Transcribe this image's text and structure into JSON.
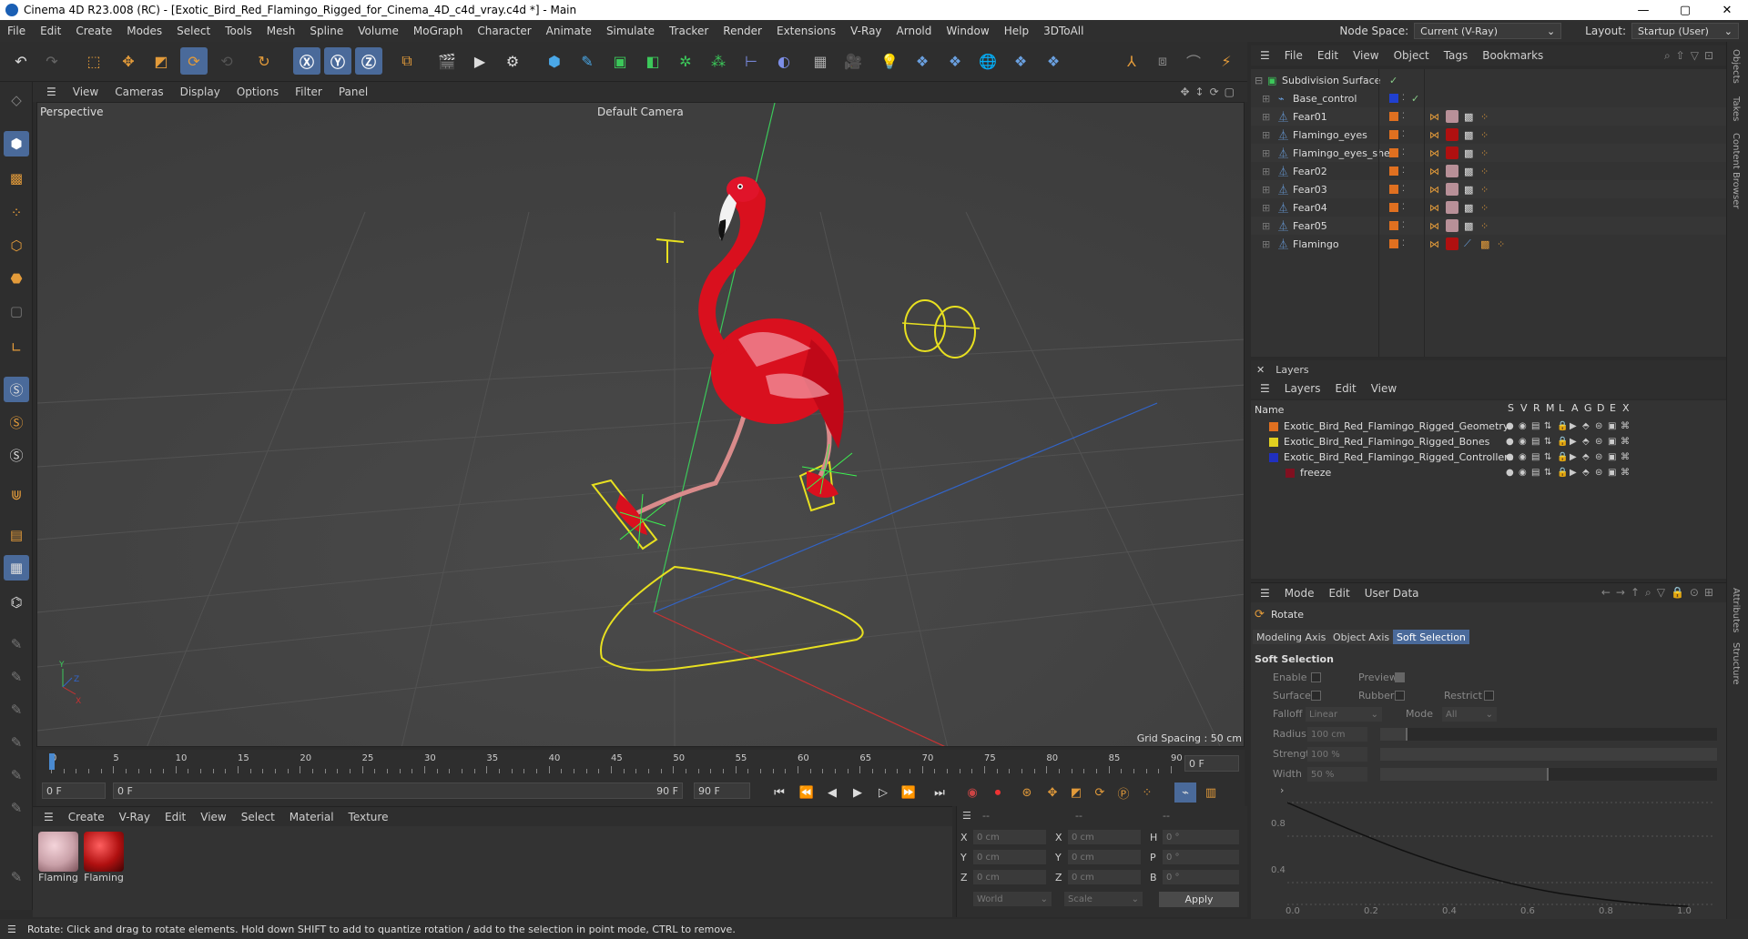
{
  "window": {
    "title": "Cinema 4D R23.008 (RC) - [Exotic_Bird_Red_Flamingo_Rigged_for_Cinema_4D_c4d_vray.c4d *] - Main",
    "controls": [
      "—",
      "▢",
      "✕"
    ]
  },
  "menubar": {
    "items": [
      "File",
      "Edit",
      "Create",
      "Modes",
      "Select",
      "Tools",
      "Mesh",
      "Spline",
      "Volume",
      "MoGraph",
      "Character",
      "Animate",
      "Simulate",
      "Tracker",
      "Render",
      "Extensions",
      "V-Ray",
      "Arnold",
      "Window",
      "Help",
      "3DToAll"
    ],
    "node_space_label": "Node Space:",
    "node_space_value": "Current (V-Ray)",
    "layout_label": "Layout:",
    "layout_value": "Startup (User)"
  },
  "viewport": {
    "menu": [
      "View",
      "Cameras",
      "Display",
      "Options",
      "Filter",
      "Panel"
    ],
    "label": "Perspective",
    "camera": "Default Camera",
    "grid_spacing": "Grid Spacing : 50 cm",
    "colors": {
      "bird": "#d9101e",
      "control": "#e8e020",
      "axis_y": "#3cc85a",
      "axis_x": "#c83232",
      "axis_z": "#3264c8"
    }
  },
  "timeline": {
    "ticks": [
      "0",
      "5",
      "10",
      "15",
      "20",
      "25",
      "30",
      "35",
      "40",
      "45",
      "50",
      "55",
      "60",
      "65",
      "70",
      "75",
      "80",
      "85",
      "90"
    ],
    "current_frame": "0 F",
    "start_field": "0 F",
    "range_start": "0 F",
    "range_end": "90 F",
    "end_field": "90 F"
  },
  "material_manager": {
    "menu": [
      "Create",
      "V-Ray",
      "Edit",
      "View",
      "Select",
      "Material",
      "Texture"
    ],
    "materials": [
      {
        "name": "Flaming",
        "color": "#c9a0a8"
      },
      {
        "name": "Flaming",
        "color": "#b01010"
      }
    ]
  },
  "coordinates": {
    "header": [
      "--",
      "--",
      "--"
    ],
    "rows": [
      {
        "a": "X",
        "av": "0 cm",
        "b": "X",
        "bv": "0 cm",
        "c": "H",
        "cv": "0 °"
      },
      {
        "a": "Y",
        "av": "0 cm",
        "b": "Y",
        "bv": "0 cm",
        "c": "P",
        "cv": "0 °"
      },
      {
        "a": "Z",
        "av": "0 cm",
        "b": "Z",
        "bv": "0 cm",
        "c": "B",
        "cv": "0 °"
      }
    ],
    "mode1": "World",
    "mode2": "Scale",
    "apply": "Apply"
  },
  "status": "Rotate: Click and drag to rotate elements. Hold down SHIFT to add to quantize rotation / add to the selection in point mode, CTRL to remove.",
  "objects": {
    "menu": [
      "File",
      "Edit",
      "View",
      "Object",
      "Tags",
      "Bookmarks"
    ],
    "items": [
      {
        "name": "Subdivision Surface",
        "color": "",
        "indent": 0
      },
      {
        "name": "Base_control",
        "color": "#2040d0",
        "indent": 1
      },
      {
        "name": "Fear01",
        "color": "#e07020",
        "indent": 1
      },
      {
        "name": "Flamingo_eyes",
        "color": "#e07020",
        "indent": 1
      },
      {
        "name": "Flamingo_eyes_shell",
        "color": "#e07020",
        "indent": 1
      },
      {
        "name": "Fear02",
        "color": "#e07020",
        "indent": 1
      },
      {
        "name": "Fear03",
        "color": "#e07020",
        "indent": 1
      },
      {
        "name": "Fear04",
        "color": "#e07020",
        "indent": 1
      },
      {
        "name": "Fear05",
        "color": "#e07020",
        "indent": 1
      },
      {
        "name": "Flamingo",
        "color": "#e07020",
        "indent": 1
      }
    ]
  },
  "side_tabs": [
    "Objects",
    "Takes",
    "Content Browser",
    "Attributes",
    "Structure"
  ],
  "layers": {
    "title": "Layers",
    "menu": [
      "Layers",
      "Edit",
      "View"
    ],
    "columns": [
      "Name",
      "S",
      "V",
      "R",
      "M",
      "L",
      "A",
      "G",
      "D",
      "E",
      "X"
    ],
    "items": [
      {
        "name": "Exotic_Bird_Red_Flamingo_Rigged_Geometry",
        "color": "#e07020"
      },
      {
        "name": "Exotic_Bird_Red_Flamingo_Rigged_Bones",
        "color": "#e0d020"
      },
      {
        "name": "Exotic_Bird_Red_Flamingo_Rigged_Controllers",
        "color": "#2030c0"
      },
      {
        "name": "freeze",
        "color": "#801020"
      }
    ]
  },
  "attributes": {
    "menu": [
      "Mode",
      "Edit",
      "User Data"
    ],
    "tool": "Rotate",
    "tabs": [
      "Modeling Axis",
      "Object Axis",
      "Soft Selection"
    ],
    "section": "Soft Selection",
    "labels": {
      "enable": "Enable",
      "preview": "Preview",
      "surface": "Surface",
      "rubber": "Rubber",
      "restrict": "Restrict",
      "falloff": "Falloff",
      "falloff_value": "Linear",
      "mode": "Mode",
      "mode_value": "All",
      "radius": "Radius",
      "radius_value": "100 cm",
      "strength": "Strength",
      "strength_value": "100 %",
      "width": "Width",
      "width_value": "50 %"
    },
    "graph_y": [
      "0.8",
      "0.4"
    ],
    "graph_x": [
      "0.0",
      "0.2",
      "0.4",
      "0.6",
      "0.8",
      "1.0"
    ]
  }
}
